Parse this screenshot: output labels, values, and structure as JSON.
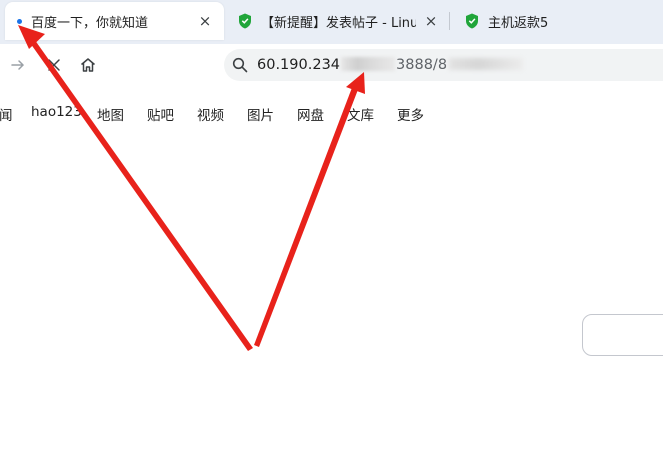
{
  "tabs": [
    {
      "title": "百度一下，你就知道",
      "active": true,
      "icon": "loading-dot-icon"
    },
    {
      "title": "【新提醒】发表帖子 - Linux面板",
      "active": false,
      "icon": "shield-icon"
    },
    {
      "title": "主机返款5",
      "active": false,
      "icon": "shield-icon"
    }
  ],
  "tab_close_glyph": "×",
  "toolbar": {
    "url_prefix": "60.190.234",
    "url_middle": "3888/8",
    "accent": "#1a73e8"
  },
  "nav_links": [
    "闻",
    "hao123",
    "地图",
    "贴吧",
    "视频",
    "图片",
    "网盘",
    "文库",
    "更多"
  ],
  "annotation_color": "#e8221b"
}
